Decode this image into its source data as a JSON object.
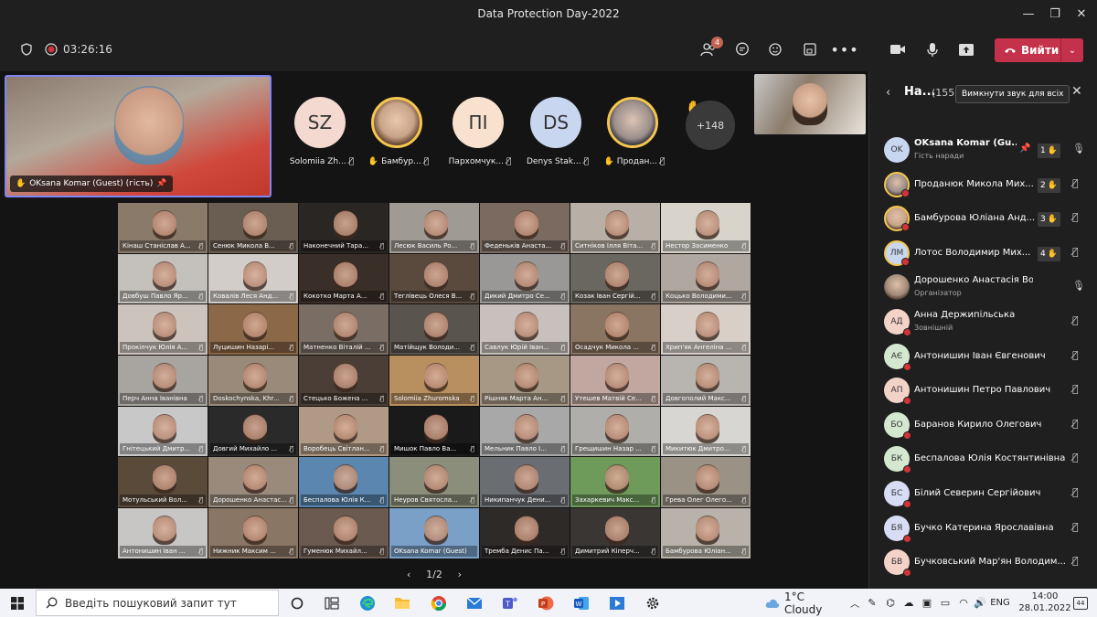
{
  "window": {
    "title": "Data Protection Day-2022",
    "minimize": "—",
    "maximize": "❐",
    "close": "✕"
  },
  "toolbar": {
    "timer": "03:26:16",
    "participants_badge": "4",
    "leave_label": "Вийти"
  },
  "pinned": {
    "name": "OKsana Komar (Guest) (гість)"
  },
  "avatars": [
    {
      "initials": "SZ",
      "name": "Solomiia Zh...",
      "color": "#f3d9cf",
      "ring": false,
      "hand": false
    },
    {
      "initials": "",
      "name": "Бамбур...",
      "color": "#c8a488",
      "ring": true,
      "hand": true
    },
    {
      "initials": "ПІ",
      "name": "Пархомчук...",
      "color": "#f8e2cf",
      "ring": false,
      "hand": false
    },
    {
      "initials": "DS",
      "name": "Denys Stak...",
      "color": "#c9d6f0",
      "ring": false,
      "hand": false
    },
    {
      "initials": "",
      "name": "Продан...",
      "color": "#9a8e8a",
      "ring": true,
      "hand": true
    }
  ],
  "more_count": "+148",
  "grid": [
    {
      "name": "Кінаш Станіслав А...",
      "bg": "#8a7a6a"
    },
    {
      "name": "Сенюк Микола В...",
      "bg": "#6a5e52"
    },
    {
      "name": "Наконечний Тара...",
      "bg": "#2a2624"
    },
    {
      "name": "Лесюк Василь Ро...",
      "bg": "#a09a94"
    },
    {
      "name": "Феденьків Анаста...",
      "bg": "#7a6a60"
    },
    {
      "name": "Ситніков Ілля Віта...",
      "bg": "#b8b0a6"
    },
    {
      "name": "Нестор Засименко",
      "bg": "#d8d4cc"
    },
    {
      "name": "Довбуш Павло Яр...",
      "bg": "#c4c0bc"
    },
    {
      "name": "Ковалів Леся Анд...",
      "bg": "#d2cdc8"
    },
    {
      "name": "Кокотко Марта А...",
      "bg": "#3a2e28"
    },
    {
      "name": "Теглівець Олеся В...",
      "bg": "#5a4a3e"
    },
    {
      "name": "Дикий Дмитро Се...",
      "bg": "#9a9896"
    },
    {
      "name": "Козак Іван Сергій...",
      "bg": "#6a6660"
    },
    {
      "name": "Коцько Володими...",
      "bg": "#b0a8a0"
    },
    {
      "name": "Прокілчук Юлія А...",
      "bg": "#ccc4bc"
    },
    {
      "name": "Луцишин Назарі...",
      "bg": "#8a6848"
    },
    {
      "name": "Матненко Віталій ...",
      "bg": "#7a6e64"
    },
    {
      "name": "Матійщук Володи...",
      "bg": "#5a544e"
    },
    {
      "name": "Савлук Юрій Іван...",
      "bg": "#c8c0bc"
    },
    {
      "name": "Осадчук Микола ...",
      "bg": "#8a7462"
    },
    {
      "name": "Хрип'як Ангеліна ...",
      "bg": "#d8d0c8"
    },
    {
      "name": "Перч Анна Іванівна",
      "bg": "#a8a4a0"
    },
    {
      "name": "Doskochynska, Khr...",
      "bg": "#9a8a7a"
    },
    {
      "name": "Стецько Божена ...",
      "bg": "#4a3e36"
    },
    {
      "name": "Solomiia Zhuromska",
      "bg": "#b89060"
    },
    {
      "name": "Рішняк Марта Ан...",
      "bg": "#a69884"
    },
    {
      "name": "Утешев Матвій Се...",
      "bg": "#c0a8a0"
    },
    {
      "name": "Довгополий Макс...",
      "bg": "#b8b4b0"
    },
    {
      "name": "Гнітецький Дмитр...",
      "bg": "#c8c8c8"
    },
    {
      "name": "Довгий Михайло ...",
      "bg": "#2a2a2a"
    },
    {
      "name": "Воробець Світлан...",
      "bg": "#b09a86"
    },
    {
      "name": "Мишок Павло Ва...",
      "bg": "#1a1a1a"
    },
    {
      "name": "Мельник Павло І...",
      "bg": "#a8a8a8"
    },
    {
      "name": "Грещишин Назар ...",
      "bg": "#b0aeaa"
    },
    {
      "name": "Микитюк Дмитро...",
      "bg": "#d8d6d2"
    },
    {
      "name": "Мотульський Вол...",
      "bg": "#5a4a3a"
    },
    {
      "name": "Дорошенко Анастас...",
      "bg": "#9a8a7c"
    },
    {
      "name": "Беспалова Юлія К...",
      "bg": "#5a86b0"
    },
    {
      "name": "Неуров Святосла...",
      "bg": "#8a8e7a"
    },
    {
      "name": "Никипанчук Дени...",
      "bg": "#6a6e72"
    },
    {
      "name": "Захаркевич Макс...",
      "bg": "#6e9a5a"
    },
    {
      "name": "Грева Олег Олего...",
      "bg": "#9a9284"
    },
    {
      "name": "Антонишин Іван ...",
      "bg": "#c8c6c4"
    },
    {
      "name": "Нижник Максим ...",
      "bg": "#8a7664"
    },
    {
      "name": "Гуменюк Михайл...",
      "bg": "#6a5a50"
    },
    {
      "name": "OKsana Komar (Guest)",
      "bg": "#7aa0c8"
    },
    {
      "name": "Тремба Денис Па...",
      "bg": "#2e2a28"
    },
    {
      "name": "Димитрий Кіперч...",
      "bg": "#3a3634"
    },
    {
      "name": "Бамбурова Юліан...",
      "bg": "#b8b2aa"
    }
  ],
  "pager": {
    "label": "1/2"
  },
  "panel": {
    "title": "На...",
    "count": "(155)",
    "mute_all": "Вимкнути звук для всіх",
    "participants": [
      {
        "initials": "OK",
        "name": "OKsana Komar (Gu...",
        "sub": "Гість наради",
        "color": "#c9d6f0",
        "ring": false,
        "hand": "1",
        "pin": true,
        "mic": "on"
      },
      {
        "initials": "",
        "name": "Проданюк Микола Мих...",
        "sub": "",
        "color": "#9a8e8a",
        "ring": true,
        "hand": "2",
        "pin": false,
        "mic": "off"
      },
      {
        "initials": "",
        "name": "Бамбурова Юліана Анд...",
        "sub": "",
        "color": "#c8a488",
        "ring": true,
        "hand": "3",
        "pin": false,
        "mic": "off"
      },
      {
        "initials": "ЛМ",
        "name": "Лотос Володимир Мих...",
        "sub": "",
        "color": "#c9d6f0",
        "ring": true,
        "hand": "4",
        "pin": false,
        "mic": "off"
      },
      {
        "initials": "",
        "name": "Дорошенко Анастасія Володи...",
        "sub": "Організатор",
        "color": "#a08878",
        "ring": false,
        "hand": "",
        "pin": false,
        "mic": "on"
      },
      {
        "initials": "АД",
        "name": "Анна Держипільська",
        "sub": "Зовнішній",
        "color": "#f3d2c8",
        "ring": false,
        "hand": "",
        "pin": false,
        "mic": "off"
      },
      {
        "initials": "АЄ",
        "name": "Антонишин Іван Євгенович",
        "sub": "",
        "color": "#d4e8d0",
        "ring": false,
        "hand": "",
        "pin": false,
        "mic": "off"
      },
      {
        "initials": "АП",
        "name": "Антонишин Петро Павлович",
        "sub": "",
        "color": "#f3d2c8",
        "ring": false,
        "hand": "",
        "pin": false,
        "mic": "off"
      },
      {
        "initials": "БО",
        "name": "Баранов Кирило Олегович",
        "sub": "",
        "color": "#d4e8d0",
        "ring": false,
        "hand": "",
        "pin": false,
        "mic": "off"
      },
      {
        "initials": "БК",
        "name": "Беспалова Юлія Костянтинівна",
        "sub": "",
        "color": "#d4e8d0",
        "ring": false,
        "hand": "",
        "pin": false,
        "mic": "off"
      },
      {
        "initials": "БС",
        "name": "Білий Северин Сергійович",
        "sub": "",
        "color": "#d8dcf4",
        "ring": false,
        "hand": "",
        "pin": false,
        "mic": "off"
      },
      {
        "initials": "БЯ",
        "name": "Бучко Катерина Ярославівна",
        "sub": "",
        "color": "#d8dcf4",
        "ring": false,
        "hand": "",
        "pin": false,
        "mic": "off"
      },
      {
        "initials": "БВ",
        "name": "Бучковський Мар'ян Володим...",
        "sub": "",
        "color": "#f3d2c8",
        "ring": false,
        "hand": "",
        "pin": false,
        "mic": "off"
      }
    ]
  },
  "taskbar": {
    "search_placeholder": "Введіть пошуковий запит тут",
    "weather": "1°C  Cloudy",
    "lang": "ENG",
    "time": "14:00",
    "date": "28.01.2022",
    "notifications": "44"
  }
}
